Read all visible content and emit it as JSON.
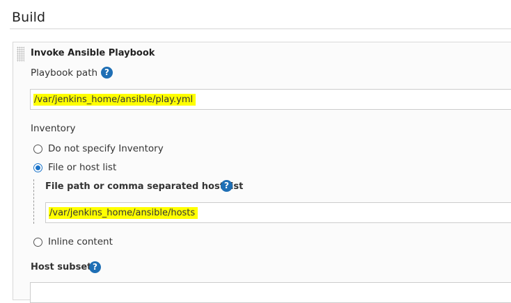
{
  "section": {
    "title": "Build"
  },
  "step": {
    "title": "Invoke Ansible Playbook",
    "playbook_path": {
      "label": "Playbook path",
      "value": "/var/jenkins_home/ansible/play.yml"
    },
    "inventory": {
      "label": "Inventory",
      "options": [
        {
          "label": "Do not specify Inventory",
          "selected": false
        },
        {
          "label": "File or host list",
          "selected": true
        },
        {
          "label": "Inline content",
          "selected": false
        }
      ],
      "file_host_list": {
        "label": "File path or comma separated host list",
        "value": "/var/jenkins_home/ansible/hosts"
      }
    },
    "host_subset": {
      "label": "Host subset",
      "value": ""
    }
  },
  "icons": {
    "help": "?"
  },
  "colors": {
    "help_icon": "#1f6fb5",
    "highlight": "#ffff00",
    "radio_selected": "#1a73c9"
  }
}
